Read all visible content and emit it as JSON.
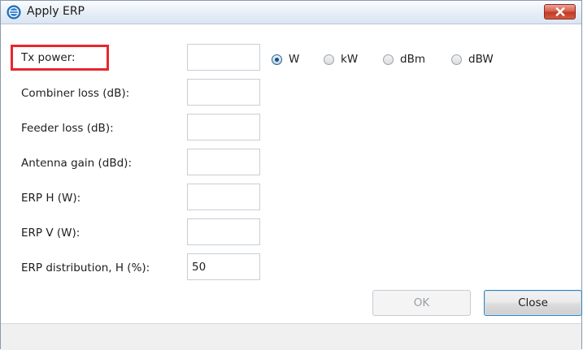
{
  "window": {
    "title": "Apply ERP",
    "close_icon": "close-icon"
  },
  "fields": [
    {
      "label": "Tx power:",
      "value": ""
    },
    {
      "label": "Combiner loss (dB):",
      "value": ""
    },
    {
      "label": "Feeder loss (dB):",
      "value": ""
    },
    {
      "label": "Antenna gain (dBd):",
      "value": ""
    },
    {
      "label": "ERP H (W):",
      "value": ""
    },
    {
      "label": "ERP V (W):",
      "value": ""
    },
    {
      "label": "ERP distribution, H (%):",
      "value": "50"
    }
  ],
  "units": {
    "selected": "W",
    "options": [
      "W",
      "kW",
      "dBm",
      "dBW"
    ]
  },
  "buttons": {
    "ok_label": "OK",
    "close_label": "Close"
  },
  "colors": {
    "highlight": "#e8262e",
    "title_gradient_top": "#fafcfe",
    "close_button": "#c23a26"
  }
}
